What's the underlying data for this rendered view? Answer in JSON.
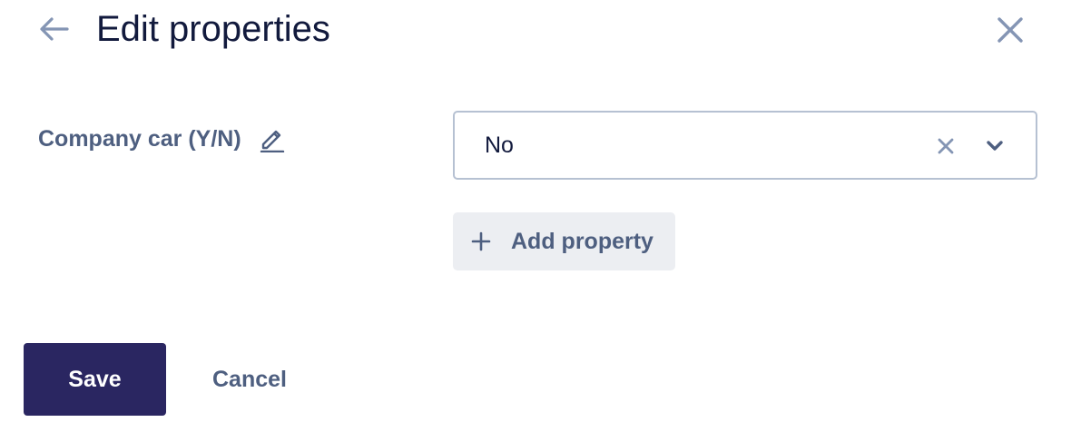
{
  "header": {
    "title": "Edit properties",
    "back_icon": "arrow-left-icon",
    "close_icon": "close-icon"
  },
  "properties": [
    {
      "label": "Company car (Y/N)",
      "edit_icon": "pencil-icon",
      "value": "No",
      "clear_icon": "clear-x-icon",
      "dropdown_icon": "chevron-down-icon"
    }
  ],
  "add_property": {
    "label": "Add property",
    "icon": "plus-icon"
  },
  "footer": {
    "save_label": "Save",
    "cancel_label": "Cancel"
  },
  "colors": {
    "title_text": "#121a3d",
    "muted_text": "#4e5f80",
    "icon": "#8495b4",
    "border": "#b6c1d2",
    "secondary_button_bg": "#eceef2",
    "primary_button_bg": "#2a2661",
    "primary_button_text": "#ffffff"
  }
}
